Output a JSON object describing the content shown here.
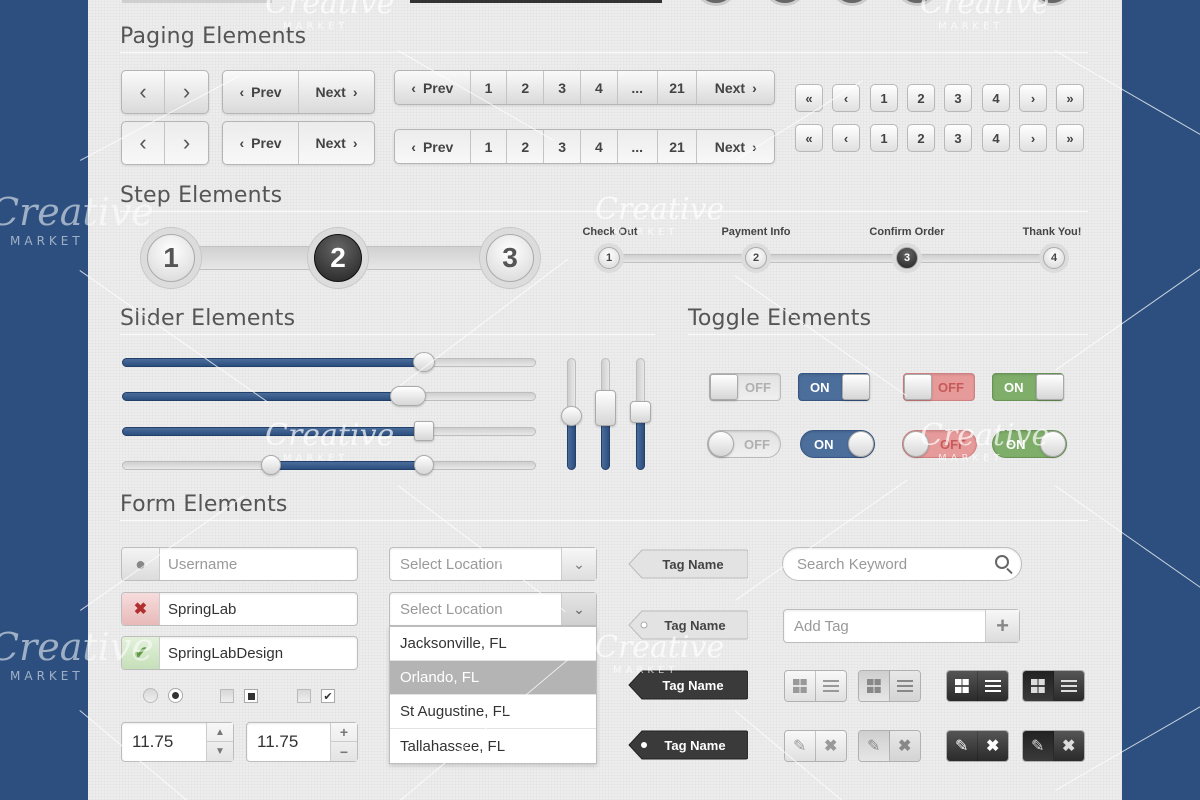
{
  "sections": {
    "paging": "Paging Elements",
    "step": "Step Elements",
    "slider": "Slider Elements",
    "toggle": "Toggle Elements",
    "form": "Form Elements"
  },
  "paging": {
    "prev": "Prev",
    "next": "Next",
    "pages": [
      "1",
      "2",
      "3",
      "4",
      "...",
      "21"
    ],
    "square_pages": [
      "1",
      "2",
      "3",
      "4"
    ]
  },
  "steps": {
    "big": [
      "1",
      "2",
      "3"
    ],
    "active_big": 2,
    "small": [
      {
        "num": "1",
        "label": "Check Out"
      },
      {
        "num": "2",
        "label": "Payment Info"
      },
      {
        "num": "3",
        "label": "Confirm Order"
      },
      {
        "num": "4",
        "label": "Thank You!"
      }
    ],
    "active_small": 3
  },
  "sliders": {
    "horizontal": [
      0.73,
      0.69,
      0.73
    ],
    "range": [
      0.36,
      0.73
    ],
    "vertical": [
      0.52,
      0.45,
      0.48
    ]
  },
  "toggles": {
    "on": "ON",
    "off": "OFF",
    "colors": {
      "blue": "#4c6e9b",
      "red": "#e79a9a",
      "green": "#7fae6a"
    }
  },
  "form": {
    "username_placeholder": "Username",
    "error_value": "SpringLab",
    "success_value": "SpringLabDesign",
    "select_placeholder": "Select Location",
    "locations": [
      "Jacksonville, FL",
      "Orlando, FL",
      "St Augustine, FL",
      "Tallahassee, FL"
    ],
    "selected_location": "Orlando, FL",
    "stepper_value": "11.75",
    "tag_name": "Tag Name",
    "search_placeholder": "Search Keyword",
    "add_tag_placeholder": "Add Tag"
  },
  "watermark": {
    "brand": "Creative",
    "sub": "MARKET"
  }
}
